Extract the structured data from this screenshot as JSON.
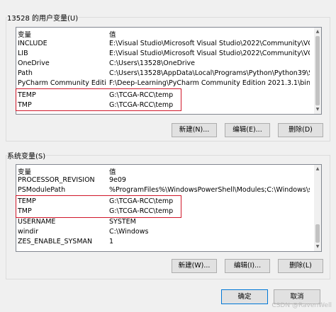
{
  "user_section": {
    "title": "13528 的用户变量(U)",
    "col_variable": "变量",
    "col_value": "值",
    "rows": [
      {
        "name": "INCLUDE",
        "value": "E:\\Visual Studio\\Microsoft Visual Studio\\2022\\Community\\VC\\T..."
      },
      {
        "name": "LIB",
        "value": "E:\\Visual Studio\\Microsoft Visual Studio\\2022\\Community\\VC\\T..."
      },
      {
        "name": "OneDrive",
        "value": "C:\\Users\\13528\\OneDrive"
      },
      {
        "name": "Path",
        "value": "C:\\Users\\13528\\AppData\\Local\\Programs\\Python\\Python39\\Scr..."
      },
      {
        "name": "PyCharm Community Edition",
        "value": "F:\\Deep-Learning\\PyCharm Community Edition 2021.3.1\\bin;"
      },
      {
        "name": "TEMP",
        "value": "G:\\TCGA-RCC\\temp"
      },
      {
        "name": "TMP",
        "value": "G:\\TCGA-RCC\\temp"
      }
    ],
    "buttons": {
      "new": "新建(N)...",
      "edit": "编辑(E)...",
      "delete": "删除(D)"
    }
  },
  "system_section": {
    "title": "系统变量(S)",
    "col_variable": "变量",
    "col_value": "值",
    "rows": [
      {
        "name": "PROCESSOR_REVISION",
        "value": "9e09"
      },
      {
        "name": "PSModulePath",
        "value": "%ProgramFiles%\\WindowsPowerShell\\Modules;C:\\Windows\\sy..."
      },
      {
        "name": "TEMP",
        "value": "G:\\TCGA-RCC\\temp"
      },
      {
        "name": "TMP",
        "value": "G:\\TCGA-RCC\\temp"
      },
      {
        "name": "USERNAME",
        "value": "SYSTEM"
      },
      {
        "name": "windir",
        "value": "C:\\Windows"
      },
      {
        "name": "ZES_ENABLE_SYSMAN",
        "value": "1"
      }
    ],
    "buttons": {
      "new": "新建(W)...",
      "edit": "编辑(I)...",
      "delete": "删除(L)"
    }
  },
  "dialog_buttons": {
    "ok": "确定",
    "cancel": "取消"
  },
  "watermark": "CSDN @RavenWell"
}
